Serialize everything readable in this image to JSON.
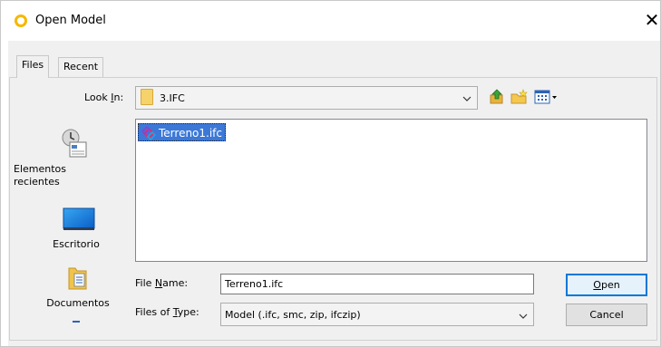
{
  "window": {
    "title": "Open Model",
    "close_glyph": "✕"
  },
  "tabs": [
    {
      "label": "Files"
    },
    {
      "label": "Recent"
    }
  ],
  "look_in": {
    "label_pre": "Look ",
    "label_mnemonic": "I",
    "label_post": "n:",
    "value": "3.IFC"
  },
  "toolbar": {
    "up_icon": "up-folder-icon",
    "new_folder_icon": "new-folder-icon",
    "view_menu_icon": "view-menu-icon"
  },
  "places": [
    {
      "label": "Elementos\nrecientes",
      "icon": "recent-items-icon"
    },
    {
      "label": "Escritorio",
      "icon": "desktop-icon"
    },
    {
      "label": "Documentos",
      "icon": "documents-icon"
    }
  ],
  "files": [
    {
      "name": "Terreno1.ifc",
      "selected": true,
      "icon": "ifc-file-icon"
    }
  ],
  "file_name": {
    "label_pre": "File ",
    "label_mnemonic": "N",
    "label_post": "ame:",
    "value": "Terreno1.ifc"
  },
  "file_type": {
    "label_pre": "Files of ",
    "label_mnemonic": "T",
    "label_post": "ype:",
    "value": "Model (.ifc, smc, zip, ifczip)"
  },
  "buttons": {
    "open_mnemonic": "O",
    "open_rest": "pen",
    "cancel": "Cancel"
  },
  "colors": {
    "selection": "#3c78d8",
    "accent_icon": "#f5b800",
    "dialog_bg": "#f0f0f0"
  }
}
